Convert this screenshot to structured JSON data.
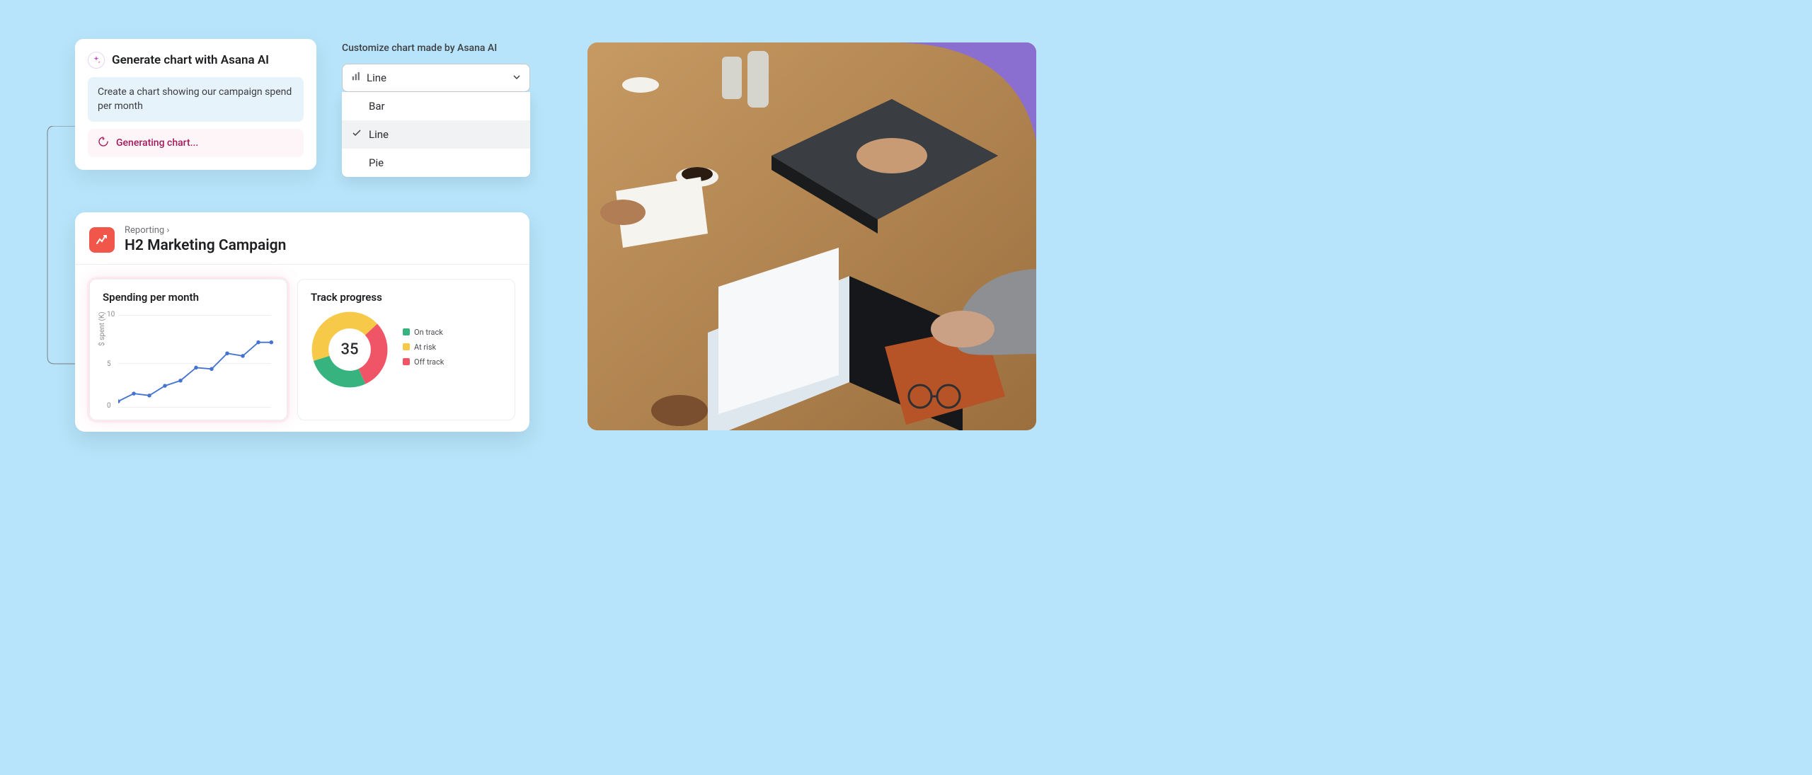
{
  "ai_card": {
    "title": "Generate chart with Asana AI",
    "prompt": "Create a chart showing our campaign spend per month",
    "status": "Generating chart..."
  },
  "customize": {
    "label": "Customize chart made by Asana AI",
    "selected": "Line",
    "options": [
      "Bar",
      "Line",
      "Pie"
    ]
  },
  "dashboard": {
    "breadcrumb": "Reporting ›",
    "title": "H2 Marketing Campaign",
    "spending": {
      "title": "Spending per month",
      "ylabel": "$ spent (K)"
    },
    "progress": {
      "title": "Track progress",
      "total": "35",
      "legend": [
        {
          "label": "On track",
          "color": "#36b37e"
        },
        {
          "label": "At risk",
          "color": "#f7c948"
        },
        {
          "label": "Off track",
          "color": "#ef5567"
        }
      ]
    }
  },
  "chart_data": [
    {
      "type": "line",
      "title": "Spending per month",
      "ylabel": "$ spent (K)",
      "ylim": [
        0,
        10
      ],
      "yticks": [
        0,
        5,
        10
      ],
      "x_index": [
        0,
        1,
        2,
        3,
        4,
        5,
        6,
        7,
        8,
        9
      ],
      "values": [
        0.5,
        1.5,
        1.2,
        2.3,
        3.0,
        4.7,
        4.5,
        6.2,
        6.0,
        7.5,
        7.5
      ]
    },
    {
      "type": "pie",
      "title": "Track progress",
      "total": 35,
      "series": [
        {
          "name": "On track",
          "value": 10,
          "color": "#36b37e"
        },
        {
          "name": "At risk",
          "value": 15,
          "color": "#f7c948"
        },
        {
          "name": "Off track",
          "value": 10,
          "color": "#ef5567"
        }
      ]
    }
  ]
}
